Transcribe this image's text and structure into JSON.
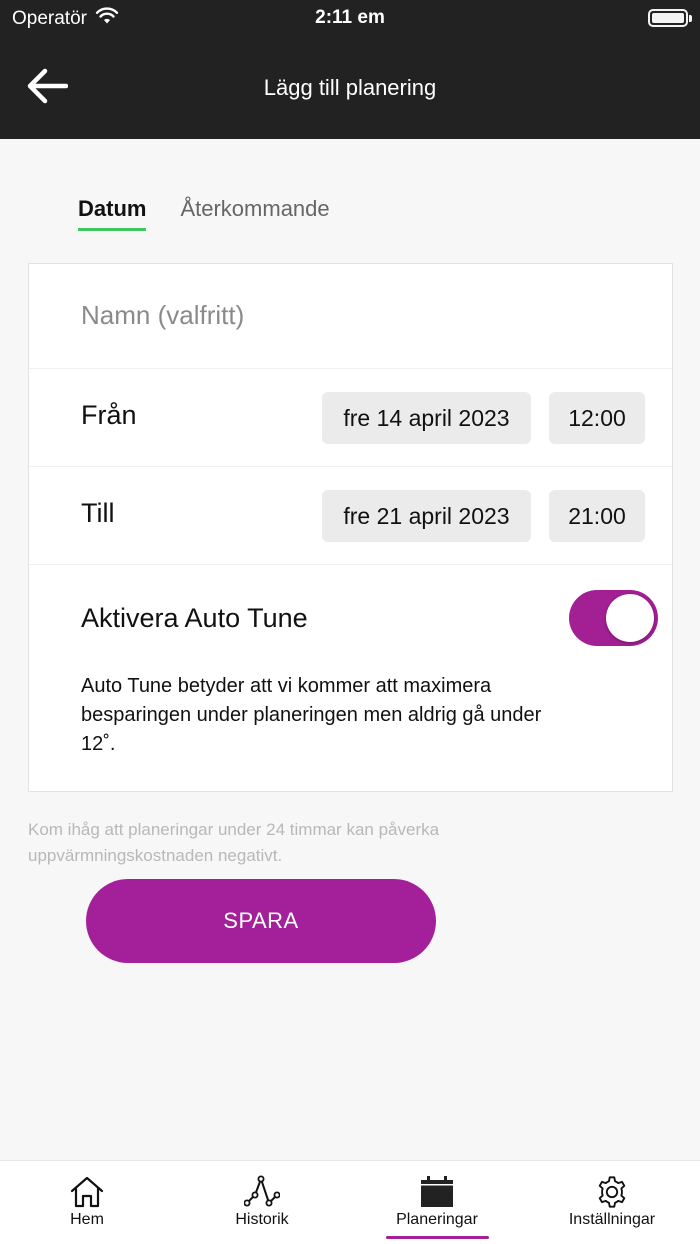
{
  "status_bar": {
    "carrier": "Operatör",
    "time": "2:11 em",
    "icons": [
      "wifi-icon",
      "battery-icon"
    ]
  },
  "header": {
    "title": "Lägg till planering",
    "back_icon": "arrow-left-icon"
  },
  "tabs": [
    {
      "label": "Datum",
      "active": true
    },
    {
      "label": "Återkommande",
      "active": false
    }
  ],
  "form": {
    "name_placeholder": "Namn (valfritt)",
    "name_value": "",
    "from": {
      "label": "Från",
      "date": "fre 14 april 2023",
      "time": "12:00"
    },
    "to": {
      "label": "Till",
      "date": "fre 21 april 2023",
      "time": "21:00"
    },
    "auto_tune": {
      "label": "Aktivera Auto Tune",
      "enabled": true,
      "description": "Auto Tune betyder att vi kommer att maximera besparingen under planeringen men aldrig gå under 12˚."
    }
  },
  "note": "Kom ihåg att planeringar under 24 timmar kan påverka uppvärmningskostnaden negativt.",
  "save_label": "SPARA",
  "colors": {
    "accent": "#a4209a",
    "tab_underline": "#3fc75a",
    "header_bg": "#222222"
  },
  "bottom_nav": {
    "items": [
      {
        "label": "Hem",
        "icon": "home-icon",
        "active": false
      },
      {
        "label": "Historik",
        "icon": "chart-line-icon",
        "active": false
      },
      {
        "label": "Planeringar",
        "icon": "calendar-icon",
        "active": true
      },
      {
        "label": "Inställningar",
        "icon": "gear-icon",
        "active": false
      }
    ]
  }
}
